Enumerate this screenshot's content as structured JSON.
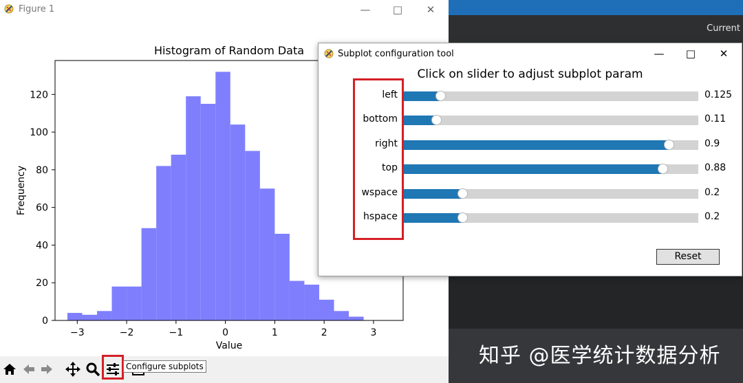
{
  "figure_window": {
    "title": "Figure 1"
  },
  "chart_data": {
    "type": "bar",
    "title": "Histogram of Random Data",
    "xlabel": "Value",
    "ylabel": "Frequency",
    "xlim": [
      -3.45,
      3.6
    ],
    "ylim": [
      0,
      138
    ],
    "xticks": [
      -3,
      -2,
      -1,
      0,
      1,
      2,
      3
    ],
    "yticks": [
      0,
      20,
      40,
      60,
      80,
      100,
      120
    ],
    "color": "#7f7ffe",
    "bin_edges": [
      -3.2,
      -2.9,
      -2.6,
      -2.3,
      -2.0,
      -1.7,
      -1.4,
      -1.1,
      -0.8,
      -0.5,
      -0.2,
      0.1,
      0.4,
      0.7,
      1.0,
      1.3,
      1.6,
      1.9,
      2.2,
      2.5,
      2.8,
      3.1
    ],
    "values": [
      4,
      3,
      5,
      18,
      18,
      49,
      82,
      88,
      119,
      115,
      132,
      104,
      90,
      70,
      46,
      21,
      19,
      11,
      5,
      2,
      0
    ],
    "grid": false
  },
  "toolbar": {
    "icons": [
      "home-icon",
      "back-icon",
      "forward-icon",
      "pan-icon",
      "zoom-icon",
      "configure-subplots-icon",
      "save-icon"
    ],
    "tooltip": "Configure subplots"
  },
  "dialog": {
    "title": "Subplot configuration tool",
    "heading": "Click on slider to adjust subplot param",
    "sliders": [
      {
        "label": "left",
        "value": 0.125,
        "value_text": "0.125"
      },
      {
        "label": "bottom",
        "value": 0.11,
        "value_text": "0.11"
      },
      {
        "label": "right",
        "value": 0.9,
        "value_text": "0.9"
      },
      {
        "label": "top",
        "value": 0.88,
        "value_text": "0.88"
      },
      {
        "label": "wspace",
        "value": 0.2,
        "value_text": "0.2"
      },
      {
        "label": "hspace",
        "value": 0.2,
        "value_text": "0.2"
      }
    ],
    "reset_label": "Reset"
  },
  "background": {
    "current_label": "Current",
    "watermark": "知乎 @医学统计数据分析"
  },
  "colors": {
    "accent_blue": "#1f77b4",
    "highlight_red": "#d41f26"
  }
}
